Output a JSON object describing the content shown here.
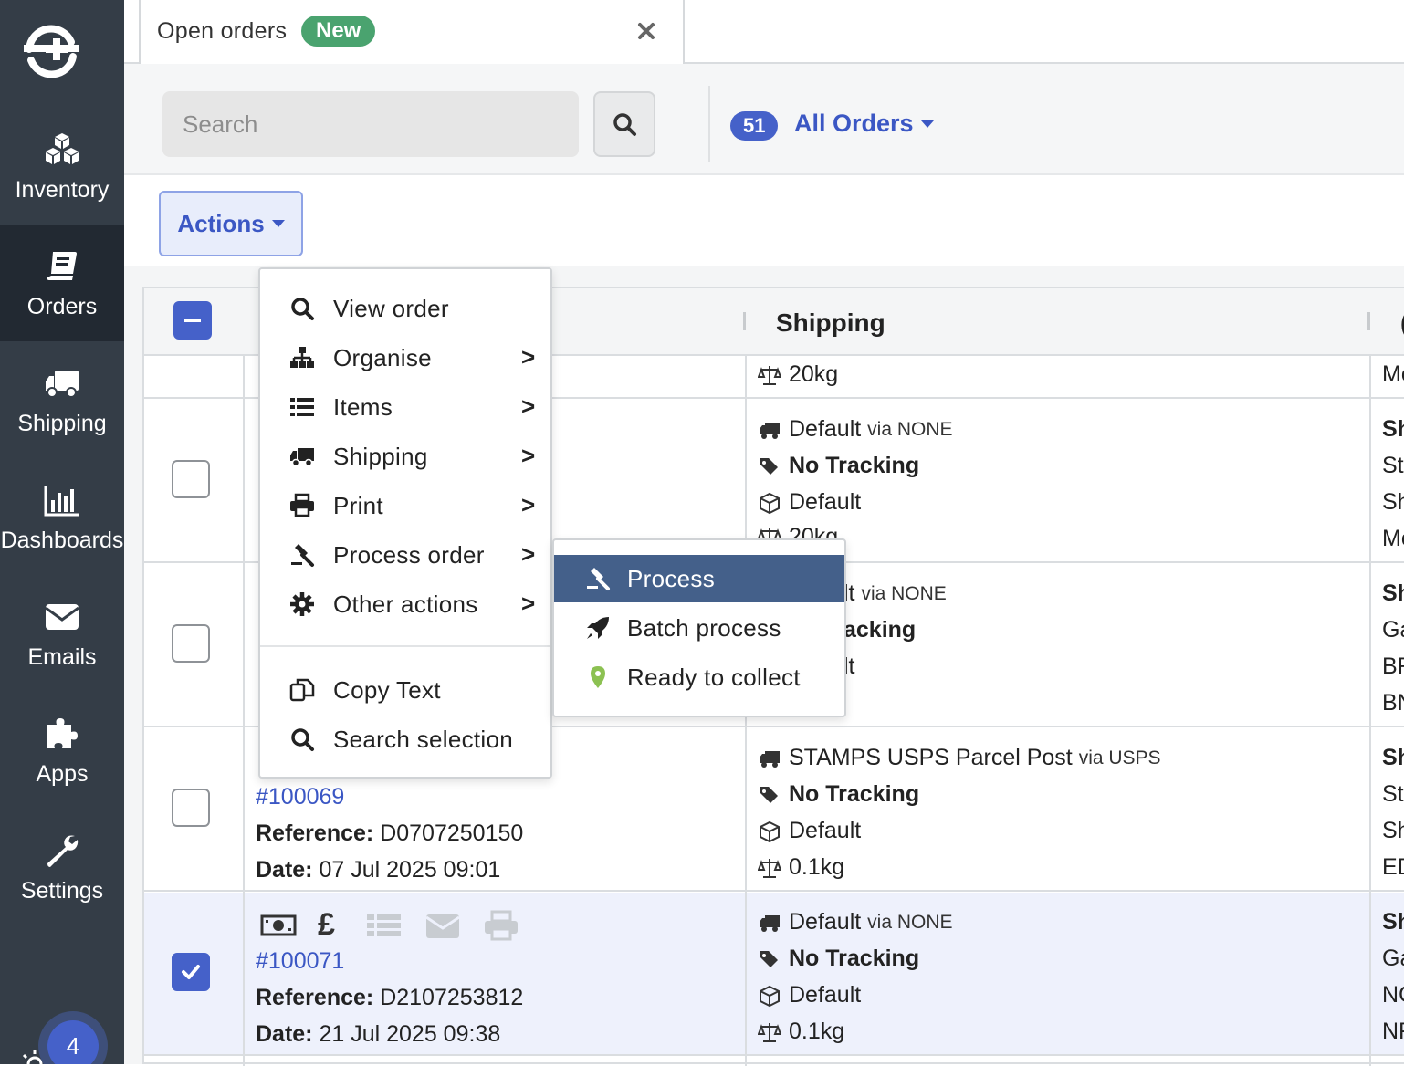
{
  "sidebar": {
    "items": [
      {
        "label": "Inventory",
        "icon": "boxes-icon"
      },
      {
        "label": "Orders",
        "icon": "book-icon"
      },
      {
        "label": "Shipping",
        "icon": "truck-icon"
      },
      {
        "label": "Dashboards",
        "icon": "bar-chart-icon"
      },
      {
        "label": "Emails",
        "icon": "envelope-icon"
      },
      {
        "label": "Apps",
        "icon": "puzzle-icon"
      },
      {
        "label": "Settings",
        "icon": "wrench-icon"
      }
    ],
    "active": "Orders",
    "notification_count": "4"
  },
  "tab": {
    "title": "Open orders",
    "badge": "New"
  },
  "toolbar": {
    "search_placeholder": "Search",
    "order_count": "51",
    "filter_label": "All Orders"
  },
  "actions": {
    "label": "Actions"
  },
  "table": {
    "header_shipping": "Shipping",
    "header_next_partial": "(",
    "rows": [
      {
        "shipping": {
          "weight": "20kg"
        },
        "next_col": [
          "Mo"
        ]
      },
      {
        "shipping": {
          "service": "Default",
          "via": "via NONE",
          "tracking": "No Tracking",
          "package": "Default",
          "weight": "20kg"
        },
        "next_col": [
          "Sh",
          "Ste",
          "Sh",
          "Mo"
        ]
      },
      {
        "shipping": {
          "service": "lt",
          "via": "via NONE",
          "tracking": "acking",
          "package": "lt"
        },
        "next_col": [
          "Sh",
          "Ga",
          "BR",
          "BN"
        ]
      },
      {
        "order_number": "#100069",
        "reference_label": "Reference:",
        "reference": "D0707250150",
        "date_label": "Date:",
        "date": "07 Jul 2025 09:01",
        "shipping": {
          "service": "STAMPS USPS Parcel Post",
          "via": "via USPS",
          "tracking": "No Tracking",
          "package": "Default",
          "weight": "0.1kg"
        },
        "next_col": [
          "Sh",
          "Ste",
          "Sh",
          "ED"
        ]
      },
      {
        "order_number": "#100071",
        "reference_label": "Reference:",
        "reference": "D2107253812",
        "date_label": "Date:",
        "date": "21 Jul 2025 09:38",
        "currency_symbol": "£",
        "shipping": {
          "service": "Default",
          "via": "via NONE",
          "tracking": "No Tracking",
          "package": "Default",
          "weight": "0.1kg"
        },
        "next_col": [
          "Sh",
          "Ga",
          "NC",
          "NF"
        ]
      }
    ]
  },
  "menu": {
    "items": [
      {
        "label": "View order",
        "icon": "search-icon",
        "arrow": ""
      },
      {
        "label": "Organise",
        "icon": "sitemap-icon",
        "arrow": ">"
      },
      {
        "label": "Items",
        "icon": "list-icon",
        "arrow": ">"
      },
      {
        "label": "Shipping",
        "icon": "truck-icon",
        "arrow": ">"
      },
      {
        "label": "Print",
        "icon": "printer-icon",
        "arrow": ">"
      },
      {
        "label": "Process order",
        "icon": "gavel-icon",
        "arrow": ">"
      },
      {
        "label": "Other actions",
        "icon": "gear-icon",
        "arrow": ">"
      },
      {
        "label": "Copy Text",
        "icon": "copy-icon",
        "arrow": ""
      },
      {
        "label": "Search selection",
        "icon": "search-icon",
        "arrow": ""
      }
    ]
  },
  "submenu": {
    "items": [
      {
        "label": "Process",
        "icon": "gavel-icon",
        "highlighted": true
      },
      {
        "label": "Batch process",
        "icon": "rocket-icon",
        "highlighted": false
      },
      {
        "label": "Ready to collect",
        "icon": "map-pin-icon",
        "highlighted": false
      }
    ]
  },
  "colors": {
    "sidebar_bg": "#343d47",
    "sidebar_active": "#222932",
    "accent_blue": "#4561c9",
    "badge_green": "#4aa36f",
    "submenu_highlight": "#44608a",
    "selected_row": "#eef1fc"
  }
}
